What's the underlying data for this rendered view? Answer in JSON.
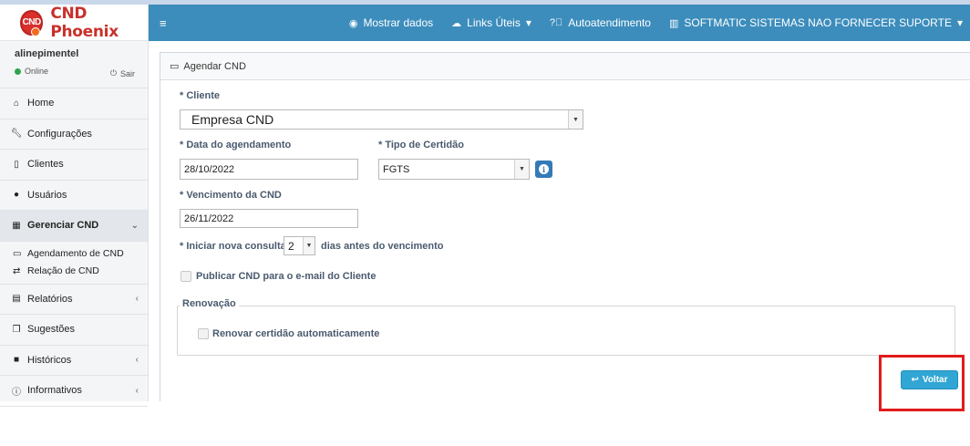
{
  "app": {
    "logo_badge": "CND",
    "logo_text": "CND Phoenix"
  },
  "user": {
    "name": "alinepimentel",
    "status": "Online",
    "logout": "Sair"
  },
  "sidebar": {
    "items": [
      {
        "label": "Home",
        "icon": "home-icon"
      },
      {
        "label": "Configurações",
        "icon": "wrench-icon"
      },
      {
        "label": "Clientes",
        "icon": "building-icon"
      },
      {
        "label": "Usuários",
        "icon": "user-icon"
      },
      {
        "label": "Gerenciar CND",
        "icon": "calendar-icon"
      },
      {
        "label": "Relatórios",
        "icon": "file-icon"
      },
      {
        "label": "Sugestões",
        "icon": "comments-icon"
      },
      {
        "label": "Históricos",
        "icon": "archive-icon"
      },
      {
        "label": "Informativos",
        "icon": "info-circle-icon"
      }
    ],
    "submenu": [
      {
        "label": "Agendamento de CND",
        "icon": "calendar-icon"
      },
      {
        "label": "Relação de CND",
        "icon": "exchange-icon"
      }
    ]
  },
  "navbar": {
    "show_data": "Mostrar dados",
    "useful_links": "Links Úteis",
    "self_service": "Autoatendimento",
    "company": "SOFTMATIC SISTEMAS NAO FORNECER SUPORTE"
  },
  "form": {
    "header": "Agendar CND",
    "cliente_label": "* Cliente",
    "cliente_value": "Empresa CND",
    "data_label": "* Data do agendamento",
    "data_value": "28/10/2022",
    "tipo_label": "* Tipo de Certidão",
    "tipo_value": "FGTS",
    "vencimento_label": "* Vencimento da CND",
    "vencimento_value": "26/11/2022",
    "consulta_prefix": "* Iniciar nova consulta",
    "consulta_value": "2",
    "consulta_suffix": "dias antes do vencimento",
    "publicar_label": "Publicar CND para o e-mail do Cliente",
    "renovacao_legend": "Renovação",
    "renovar_label": "Renovar certidão automaticamente",
    "voltar": "Voltar"
  },
  "colors": {
    "navbar": "#3c8dbc",
    "brand": "#c8312c",
    "voltar_button": "#31a6d4",
    "highlight": "#e21b1b"
  }
}
